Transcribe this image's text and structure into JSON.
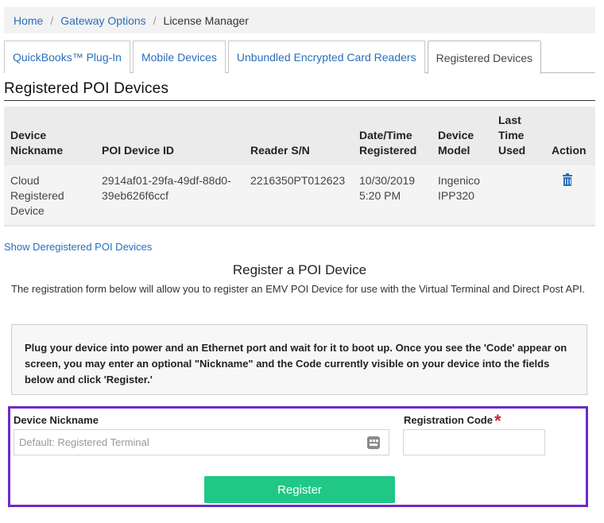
{
  "breadcrumb": {
    "items": [
      {
        "label": "Home"
      },
      {
        "label": "Gateway Options"
      },
      {
        "label": "License Manager"
      }
    ],
    "separator": "/"
  },
  "tabs": [
    {
      "label": "QuickBooks™ Plug-In",
      "active": false
    },
    {
      "label": "Mobile Devices",
      "active": false
    },
    {
      "label": "Unbundled Encrypted Card Readers",
      "active": false
    },
    {
      "label": "Registered Devices",
      "active": true
    }
  ],
  "section_title": "Registered POI Devices",
  "table": {
    "headers": {
      "nickname": "Device Nickname",
      "poi_id": "POI Device ID",
      "reader_sn": "Reader S/N",
      "date": "Date/Time Registered",
      "model": "Device Model",
      "last_used": "Last Time Used",
      "action": "Action"
    },
    "rows": [
      {
        "nickname": "Cloud Registered Device",
        "poi_id": "2914af01-29fa-49df-88d0-39eb626f6ccf",
        "reader_sn": "2216350PT012623",
        "date": "10/30/2019 5:20 PM",
        "model": "Ingenico IPP320",
        "last_used": "",
        "action_icon": "trash-icon"
      }
    ]
  },
  "show_deregistered_label": "Show Deregistered POI Devices",
  "register": {
    "title": "Register a POI Device",
    "description": "The registration form below will allow you to register an EMV POI Device for use with the Virtual Terminal and Direct Post API.",
    "instructions": "Plug your device into power and an Ethernet port and wait for it to boot up. Once you see the 'Code' appear on screen, you may enter an optional \"Nickname\" and the Code currently visible on your device into the fields below and click 'Register.'",
    "nickname_label": "Device Nickname",
    "nickname_placeholder": "Default: Registered Terminal",
    "nickname_value": "",
    "code_label": "Registration Code",
    "required_marker": "*",
    "code_value": "",
    "button_label": "Register"
  },
  "colors": {
    "link": "#2a6ebb",
    "button": "#21c785",
    "highlight_border": "#6a2cc6",
    "required": "#d0213a"
  }
}
